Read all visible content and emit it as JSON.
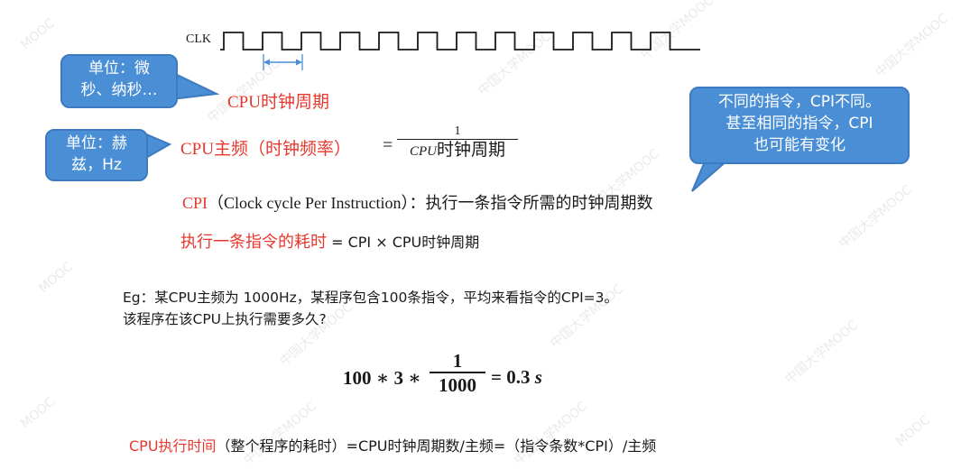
{
  "clock": {
    "label": "CLK",
    "cycle_label": "CPU时钟周期"
  },
  "callouts": {
    "unit_time": "单位：微\n秒、纳秒…",
    "unit_freq": "单位：赫\n兹，Hz",
    "cpi_note": "不同的指令，CPI不同。\n甚至相同的指令，CPI\n也可能有变化"
  },
  "definitions": {
    "freq_label": "CPU主频（时钟频率）",
    "freq_eq": "=",
    "freq_num": "1",
    "freq_den_cpu": "CPU",
    "freq_den_rest": "时钟周期",
    "cpi_label": "CPI",
    "cpi_text": "（Clock cycle Per Instruction）：执行一条指令所需的时钟周期数",
    "instr_time_label": "执行一条指令的耗时",
    "instr_time_formula": " = CPI × CPU时钟周期"
  },
  "example": {
    "line1": "Eg：某CPU主频为 1000Hz，某程序包含100条指令，平均来看指令的CPI=3。",
    "line2": "该程序在该CPU上执行需要多久?",
    "formula_left": "100 ∗ 3 ∗",
    "formula_num": "1",
    "formula_den": "1000",
    "formula_right": "= 0.3",
    "formula_unit": "s"
  },
  "summary": {
    "label": "CPU执行时间",
    "text": "（整个程序的耗时）=CPU时钟周期数/主频=（指令条数*CPI）/主频"
  },
  "colors": {
    "highlight": "#e8372d",
    "callout": "#4a8fd6",
    "cycle_arrow": "#4a8fd6"
  }
}
